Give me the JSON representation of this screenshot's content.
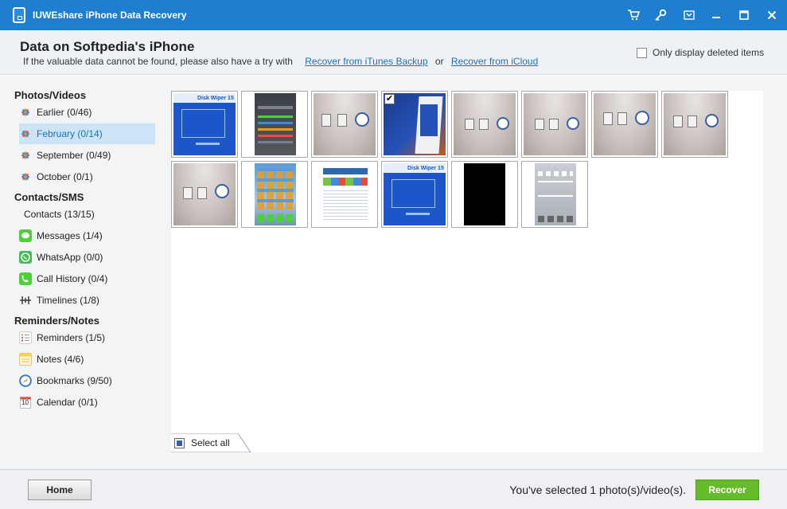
{
  "window": {
    "title": "IUWEshare iPhone Data Recovery"
  },
  "header": {
    "device_title": "Data on Softpedia's iPhone",
    "hint_prefix": "If the valuable data cannot be found, please also have a try with",
    "itunes_link": "Recover from iTunes Backup",
    "or_text": "or",
    "icloud_link": "Recover from iCloud",
    "only_deleted_label": "Only display deleted items",
    "only_deleted_checked": false
  },
  "sidebar": {
    "sections": [
      {
        "title": "Photos/Videos",
        "items": [
          {
            "label": "Earlier (0/46)",
            "icon": "photos-icon",
            "active": false
          },
          {
            "label": "February (0/14)",
            "icon": "photos-icon",
            "active": true
          },
          {
            "label": "September (0/49)",
            "icon": "photos-icon",
            "active": false
          },
          {
            "label": "October (0/1)",
            "icon": "photos-icon",
            "active": false
          }
        ]
      },
      {
        "title": "Contacts/SMS",
        "items": [
          {
            "label": "Contacts (13/15)",
            "icon": "",
            "active": false
          },
          {
            "label": "Messages (1/4)",
            "icon": "messages-icon",
            "active": false
          },
          {
            "label": "WhatsApp (0/0)",
            "icon": "whatsapp-icon",
            "active": false
          },
          {
            "label": "Call History (0/4)",
            "icon": "phone-icon",
            "active": false
          },
          {
            "label": "Timelines (1/8)",
            "icon": "timeline-icon",
            "active": false
          }
        ]
      },
      {
        "title": "Reminders/Notes",
        "items": [
          {
            "label": "Reminders (1/5)",
            "icon": "reminders-icon",
            "active": false
          },
          {
            "label": "Notes (4/6)",
            "icon": "notes-icon",
            "active": false
          },
          {
            "label": "Bookmarks (9/50)",
            "icon": "safari-icon",
            "active": false
          },
          {
            "label": "Calendar (0/1)",
            "icon": "calendar-icon",
            "active": false
          }
        ]
      }
    ],
    "calendar_icon_day": "10"
  },
  "thumbnails": [
    {
      "kind": "disk-wiper",
      "checked": false
    },
    {
      "kind": "iphone-settings",
      "checked": false
    },
    {
      "kind": "desk-photo",
      "checked": false
    },
    {
      "kind": "blue-box",
      "checked": true
    },
    {
      "kind": "desk-photo",
      "checked": false
    },
    {
      "kind": "desk-photo",
      "checked": false
    },
    {
      "kind": "desk-photo",
      "checked": false
    },
    {
      "kind": "desk-photo",
      "checked": false
    },
    {
      "kind": "desk-photo",
      "checked": false
    },
    {
      "kind": "iphone-home",
      "checked": false
    },
    {
      "kind": "webpage",
      "checked": false
    },
    {
      "kind": "disk-wiper",
      "checked": false
    },
    {
      "kind": "black",
      "checked": false
    },
    {
      "kind": "control-center",
      "checked": false
    }
  ],
  "thumb_text": {
    "disk_wiper": "Disk Wiper 15"
  },
  "grid": {
    "select_all_label": "Select all",
    "check_mark": "✔"
  },
  "footer": {
    "home_label": "Home",
    "status_text": "You've selected 1 photo(s)/video(s).",
    "recover_label": "Recover"
  },
  "colors": {
    "titlebar": "#1e7fd1",
    "accent_link": "#1d6fc1",
    "active_item_bg": "#cce4f7",
    "recover_button": "#66bb2b"
  }
}
